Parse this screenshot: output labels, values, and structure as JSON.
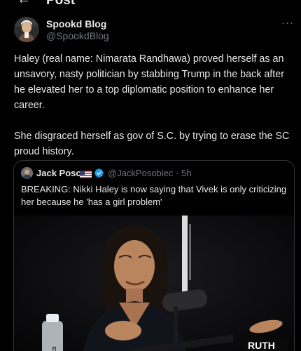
{
  "header": {
    "title": "Post",
    "back_icon": "back-arrow-icon"
  },
  "post": {
    "author": {
      "name": "Spookd Blog",
      "handle": "@SpookdBlog"
    },
    "more_icon": "more-options-icon",
    "paragraphs": [
      "Haley (real name: Nimarata Randhawa) proved herself as an unsavory, nasty politician by stabbing Trump in the back after he elevated her to a top diplomatic position to enhance her career.",
      "She disgraced herself as gov of S.C. by trying to erase the SC proud history."
    ]
  },
  "quote": {
    "author": {
      "name": "Jack Poso",
      "handle": "@JackPosobiec",
      "time": "5h",
      "separator": "·"
    },
    "flag_icon": "us-flag-icon",
    "verified_icon": "verified-badge-icon",
    "verified_color": "#1d9bf0",
    "text": "BREAKING: Nikki Haley is now saying that Vivek is only criticizing her because he 'has a girl problem'",
    "media": {
      "overlay_text": "RUTH",
      "bottle_label": "ita"
    }
  },
  "colors": {
    "background": "#000000",
    "text": "#e7e9ea",
    "secondary": "#71767b",
    "border": "#333639"
  }
}
